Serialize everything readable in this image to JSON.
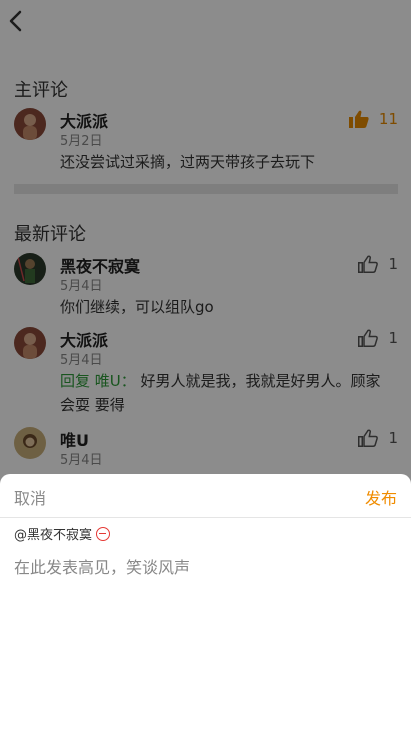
{
  "sections": {
    "main_title": "主评论",
    "latest_title": "最新评论"
  },
  "main_comment": {
    "name": "大派派",
    "date": "5月2日",
    "text": "还没尝试过采摘，过两天带孩子去玩下",
    "likes": "11"
  },
  "latest_comments": [
    {
      "name": "黑夜不寂寞",
      "date": "5月4日",
      "text": "你们继续，可以组队go",
      "likes": "1"
    },
    {
      "name": "大派派",
      "date": "5月4日",
      "reply_prefix": "回复 唯U：",
      "text": "好男人就是我，我就是好男人。顾家 会耍 要得",
      "likes": "1"
    },
    {
      "name": "唯U",
      "date": "5月4日",
      "text": "",
      "likes": "1"
    }
  ],
  "sheet": {
    "cancel_label": "取消",
    "publish_label": "发布",
    "mention": "@黑夜不寂寞",
    "placeholder": "在此发表高见，笑谈风声"
  },
  "colors": {
    "accent": "#f08c00",
    "reply": "#2e9b3a",
    "remove": "#e53935"
  }
}
